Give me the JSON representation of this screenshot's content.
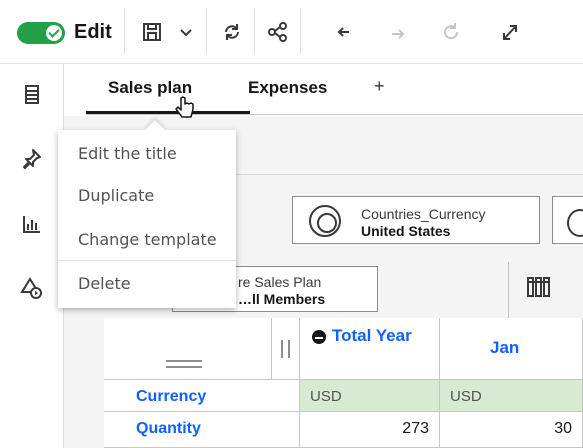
{
  "toolbar": {
    "edit_label": "Edit",
    "edit_toggle_on": true,
    "accent_color": "#24a148"
  },
  "tabs": [
    {
      "label": "Sales plan",
      "active": true
    },
    {
      "label": "Expenses",
      "active": false
    }
  ],
  "tab_add_label": "+",
  "context_menu": {
    "items": [
      "Edit the title",
      "Duplicate",
      "Change template",
      "Delete"
    ]
  },
  "dimensions": {
    "country": {
      "name": "Countries_Currency",
      "value": "United States"
    },
    "plan": {
      "name": "re Sales Plan",
      "value": "…ll Members"
    }
  },
  "grid": {
    "columns": [
      "Total Year",
      "Jan"
    ],
    "rows": [
      {
        "label": "Currency",
        "values": [
          "USD",
          "USD"
        ]
      },
      {
        "label": "Quantity",
        "values": [
          "273",
          "30"
        ]
      }
    ],
    "highlight_color": "#d9ead3",
    "link_color": "#0f62fe"
  },
  "icons": {
    "toolbar": [
      "save-icon",
      "chevron-down-icon",
      "refresh-icon",
      "share-icon",
      "undo-icon",
      "redo-icon",
      "reset-icon",
      "expand-icon"
    ],
    "sidebar": [
      "pages-icon",
      "pin-icon",
      "chart-icon",
      "shapes-icon"
    ]
  }
}
